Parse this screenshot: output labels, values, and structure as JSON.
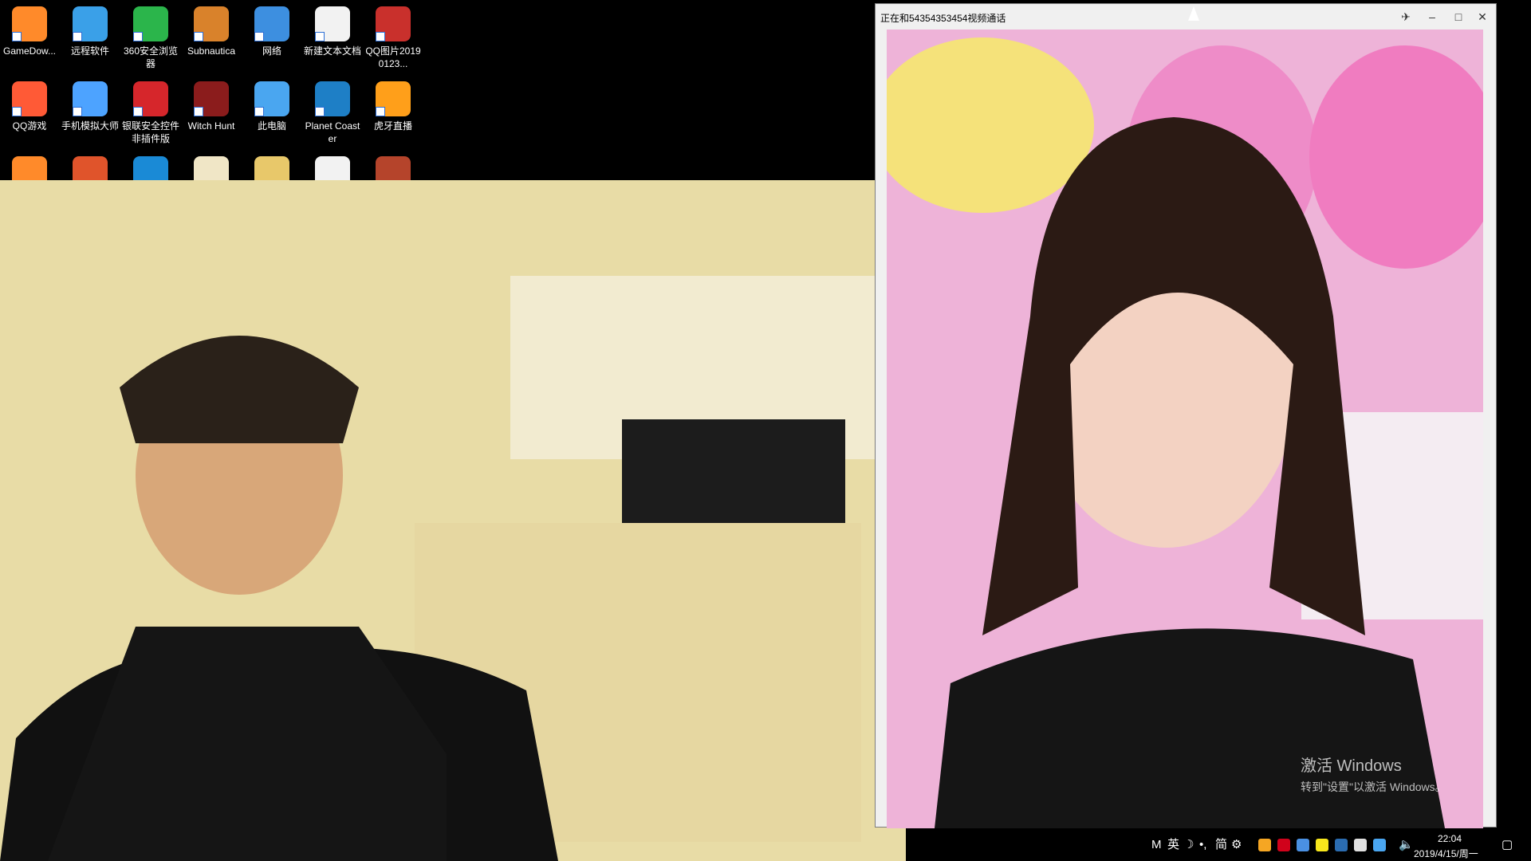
{
  "desktop": {
    "icons": [
      {
        "label": "GameDow...",
        "color": "#ff8a2a"
      },
      {
        "label": "远程软件",
        "color": "#3aa0e8"
      },
      {
        "label": "360安全浏览器",
        "color": "#2bb54b"
      },
      {
        "label": "Subnautica",
        "color": "#d9822b"
      },
      {
        "label": "网络",
        "color": "#3d8fe0"
      },
      {
        "label": "新建文本文档",
        "color": "#f2f2f2"
      },
      {
        "label": "QQ图片20190123...",
        "color": "#c9302c"
      },
      {
        "label": "QQ游戏",
        "color": "#ff5a36"
      },
      {
        "label": "手机模拟大师",
        "color": "#4da3ff"
      },
      {
        "label": "银联安全控件非插件版",
        "color": "#d6262b"
      },
      {
        "label": "Witch Hunt",
        "color": "#8b1c1c"
      },
      {
        "label": "此电脑",
        "color": "#4aa6f0"
      },
      {
        "label": "Planet Coaster",
        "color": "#1e7fc6"
      },
      {
        "label": "虎牙直播",
        "color": "#ff9f1a"
      },
      {
        "label": "",
        "color": "#ff8a2a"
      },
      {
        "label": "",
        "color": "#e0542b"
      },
      {
        "label": "",
        "color": "#1a8ad6"
      },
      {
        "label": "",
        "color": "#f0e6c6"
      },
      {
        "label": "",
        "color": "#e8c86a"
      },
      {
        "label": "",
        "color": "#f2f2f2"
      },
      {
        "label": "",
        "color": "#b5442b"
      }
    ]
  },
  "call_window": {
    "title": "正在和54354353454视频通话",
    "buttons": {
      "pin": "✈",
      "minimize": "–",
      "maximize": "□",
      "close": "✕"
    }
  },
  "watermark": {
    "title": "激活 Windows",
    "subtitle": "转到\"设置\"以激活 Windows。"
  },
  "taskbar": {
    "tray_text": [
      "M",
      "英",
      "☽",
      "•,",
      "简",
      "⚙"
    ],
    "tray_icons": [
      "#f5a623",
      "#d0021b",
      "#4a90e2",
      "#f8e71c",
      "#2b6cb0",
      "#e0e0e0",
      "#4aa6f0"
    ],
    "time": "22:04",
    "date": "2019/4/15/周一",
    "volume_icon": "🔈",
    "notification_icon": "▢"
  }
}
